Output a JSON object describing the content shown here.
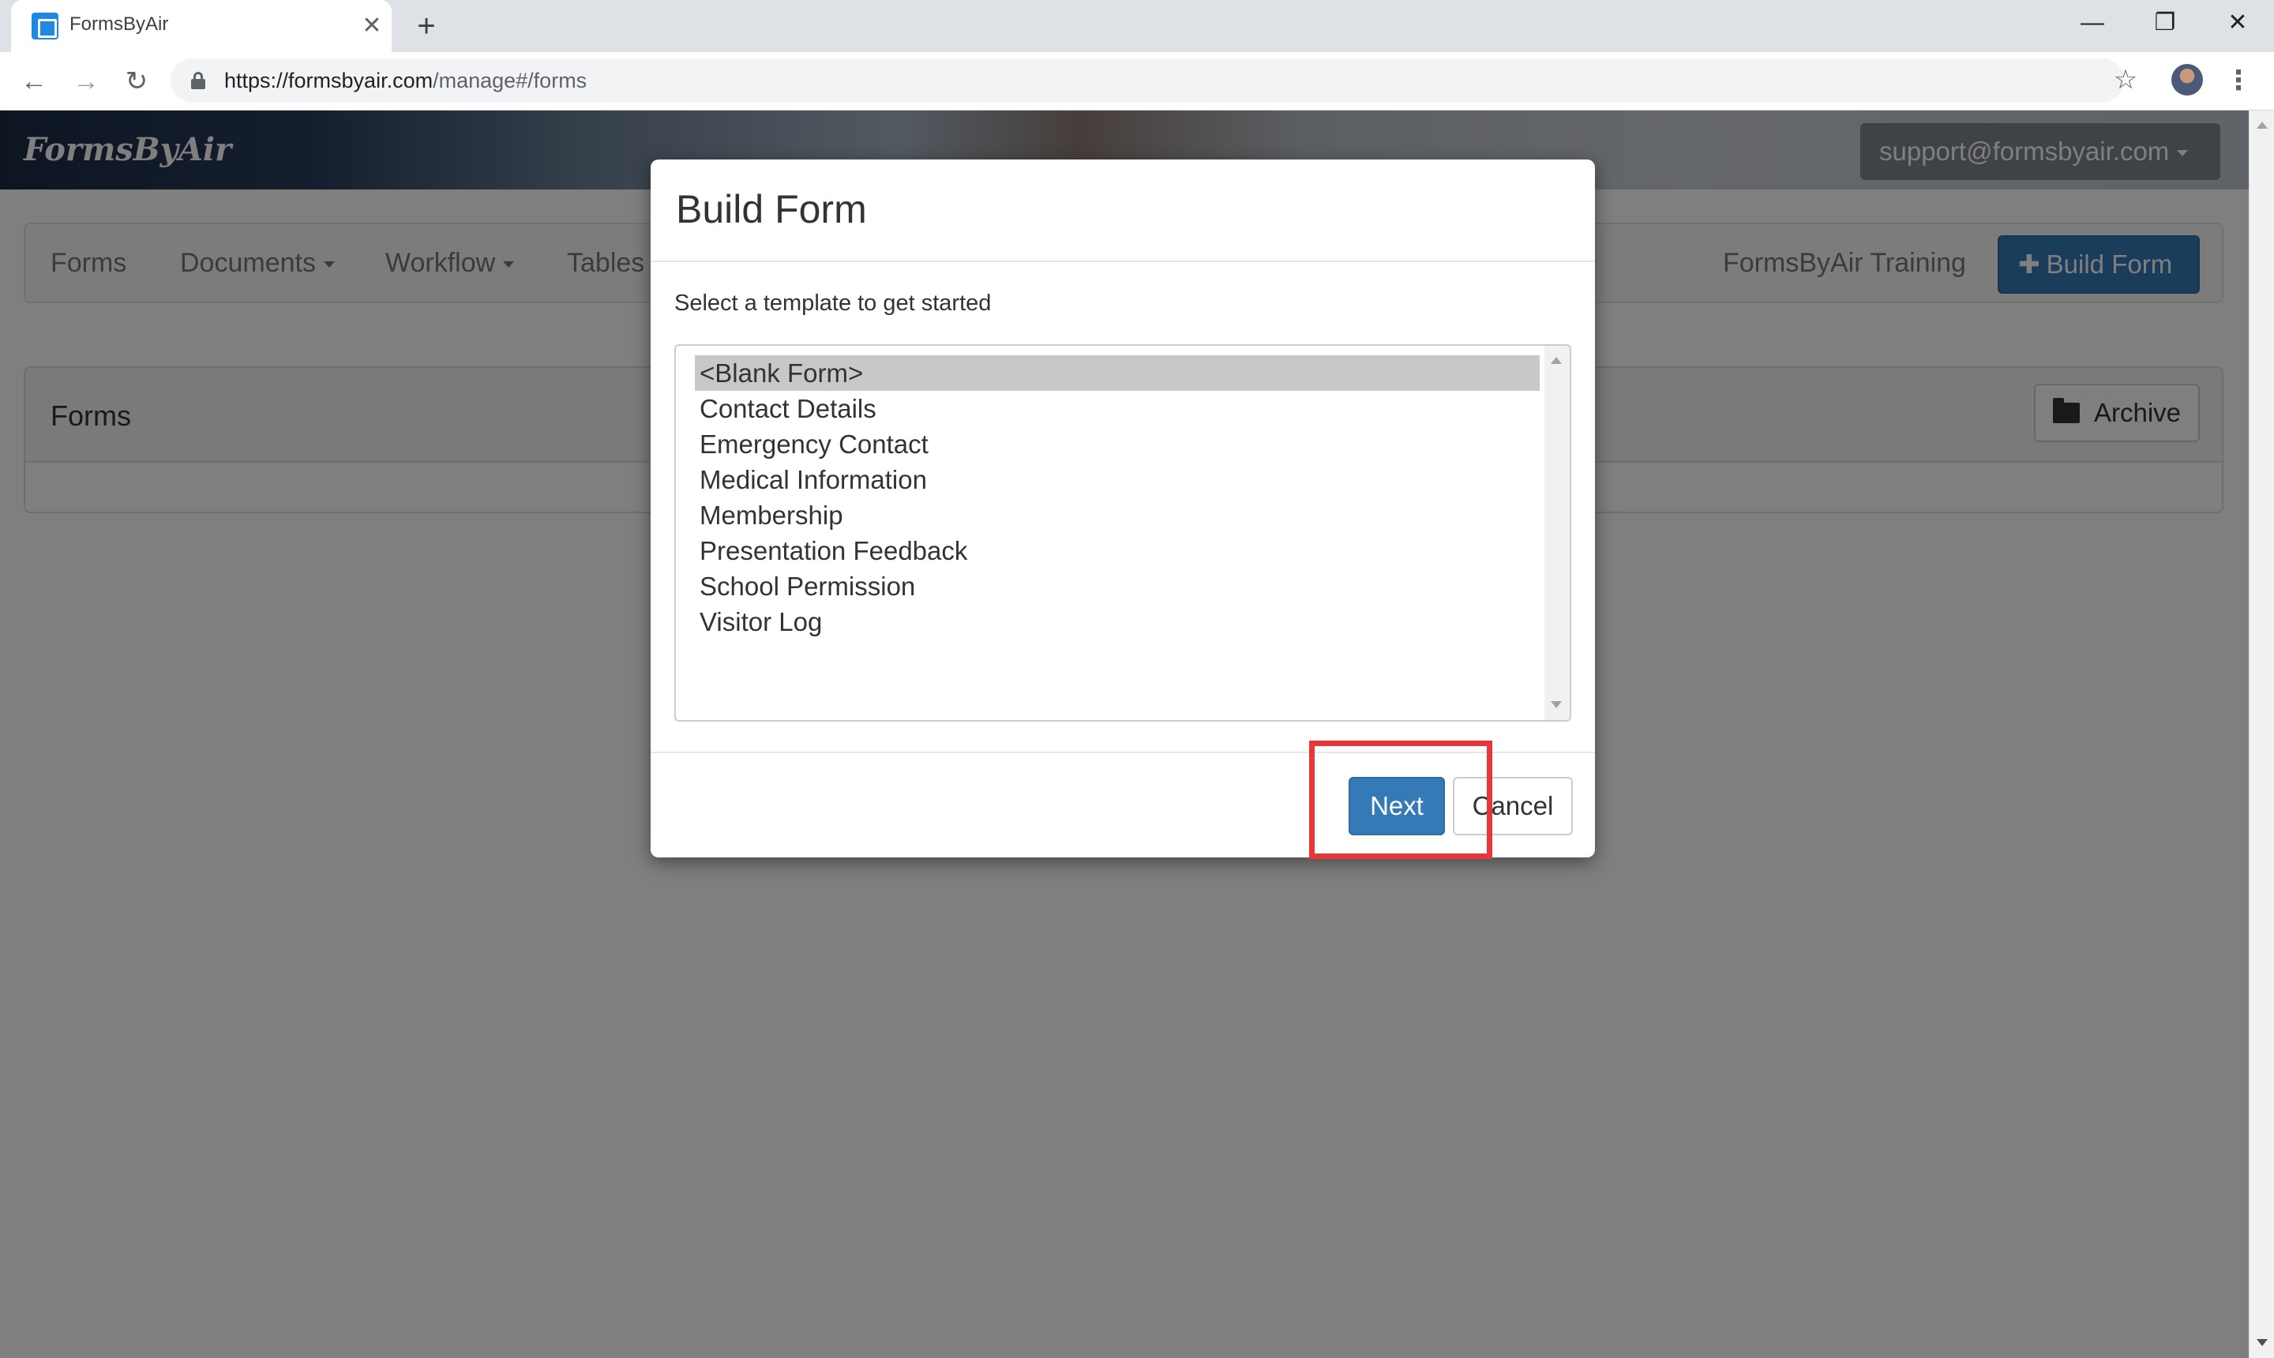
{
  "browser": {
    "tab_title": "FormsByAir",
    "tab_close": "✕",
    "new_tab": "+",
    "url_host": "https://formsbyair.com",
    "url_path": "/manage#/forms",
    "window_minimize": "—",
    "window_restore": "❐",
    "window_close": "✕",
    "back": "←",
    "forward": "→",
    "reload": "↻",
    "bookmark": "☆",
    "menu": "⋮"
  },
  "app": {
    "brand": "FormsByAir",
    "account": "support@formsbyair.com",
    "nav": {
      "forms": "Forms",
      "documents": "Documents",
      "workflow": "Workflow",
      "tables": "Tables",
      "training": "FormsByAir Training",
      "build_form": "Build Form"
    },
    "panel": {
      "title": "Forms",
      "archive": "Archive"
    }
  },
  "modal": {
    "title": "Build Form",
    "subtitle": "Select a template to get started",
    "templates": [
      "<Blank Form>",
      "Contact Details",
      "Emergency Contact",
      "Medical Information",
      "Membership",
      "Presentation Feedback",
      "School Permission",
      "Visitor Log"
    ],
    "selected_template": "<Blank Form>",
    "next": "Next",
    "cancel": "Cancel"
  },
  "colors": {
    "primary": "#337ab7",
    "highlight": "#e8373b"
  }
}
